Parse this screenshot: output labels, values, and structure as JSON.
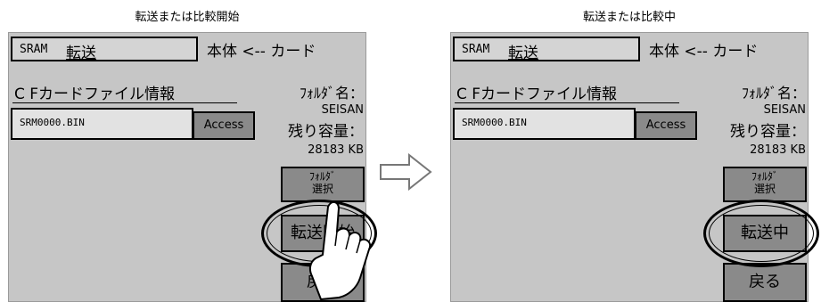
{
  "captions": {
    "left": "転送または比較開始",
    "right": "転送または比較中"
  },
  "screens": [
    {
      "title_prefix": "SRAM",
      "title_main": "転送",
      "direction": "本体 <-- カード",
      "cf_label": "C Fカードファイル情報",
      "file_name": "SRM0000.BIN",
      "access_label": "Access",
      "folder_label": "ﾌｫﾙﾀﾞ名：",
      "folder_name": "SEISAN",
      "remaining_label": "残り容量：",
      "remaining_value": "28183 KB",
      "select_button": "ﾌｫﾙﾀﾞ\n選択",
      "action_button": "転送開始",
      "back_button": "戻る"
    },
    {
      "title_prefix": "SRAM",
      "title_main": "転送",
      "direction": "本体 <-- カード",
      "cf_label": "C Fカードファイル情報",
      "file_name": "SRM0000.BIN",
      "access_label": "Access",
      "folder_label": "ﾌｫﾙﾀﾞ名：",
      "folder_name": "SEISAN",
      "remaining_label": "残り容量：",
      "remaining_value": "28183 KB",
      "select_button": "ﾌｫﾙﾀﾞ\n選択",
      "action_button": "転送中",
      "back_button": "戻る"
    }
  ],
  "icons": {
    "transition": "right-arrow-icon",
    "pointer": "pointing-hand-icon"
  }
}
